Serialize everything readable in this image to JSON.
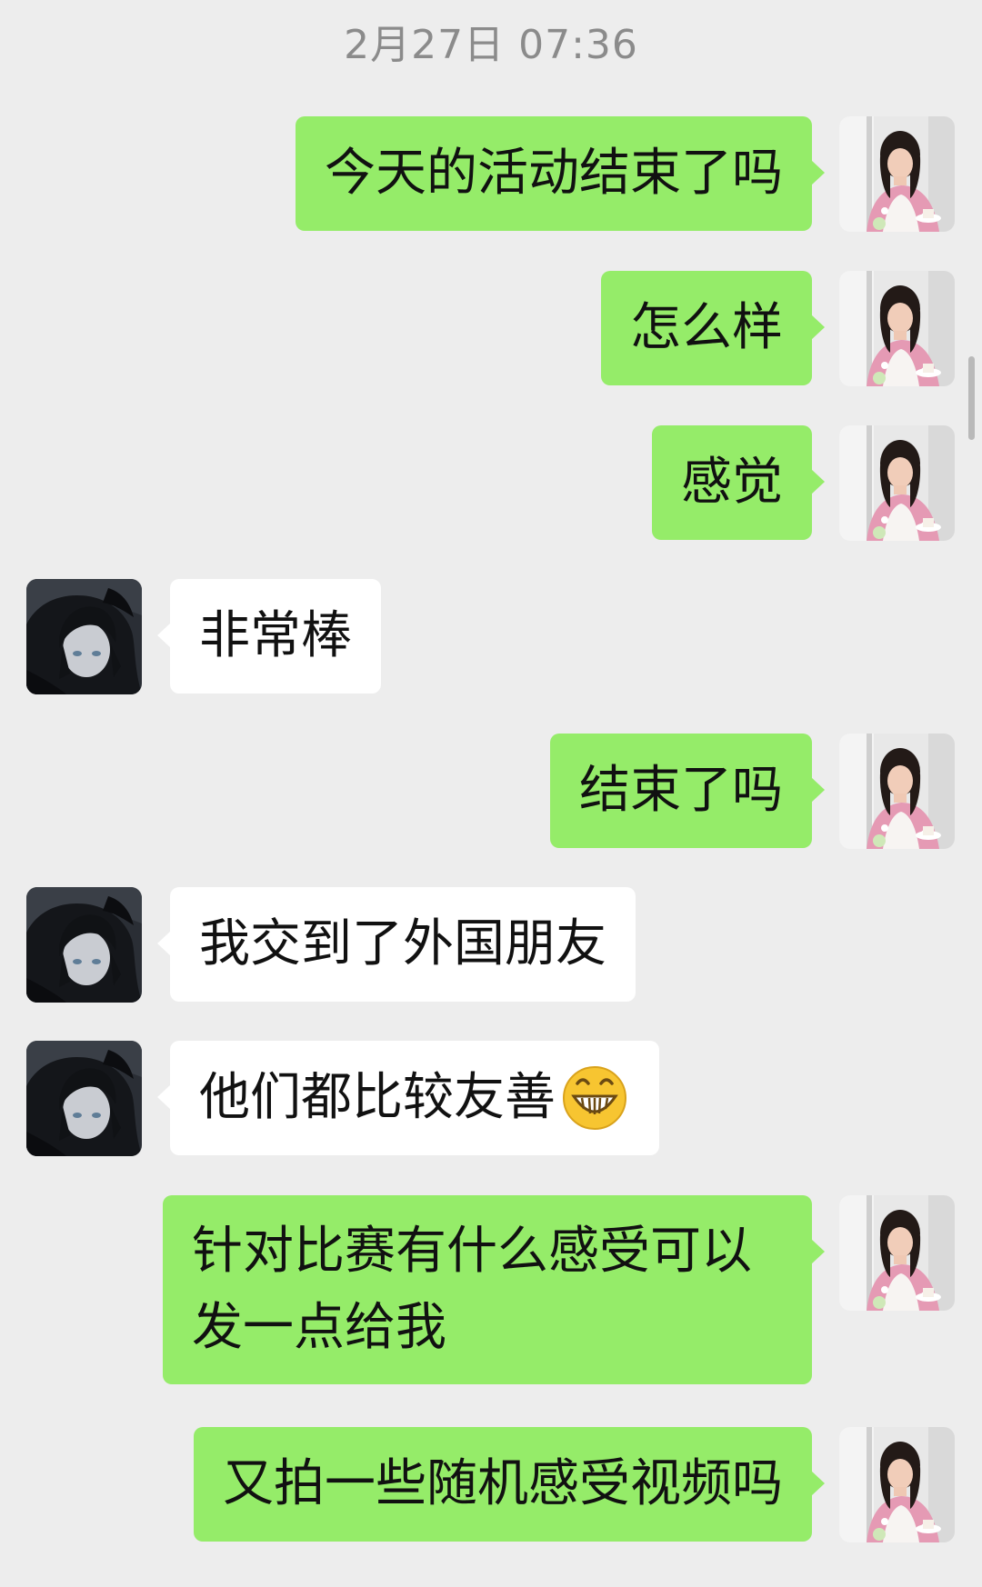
{
  "chat": {
    "timestamp": "2月27日 07:36",
    "messages": [
      {
        "side": "out",
        "text": "今天的活动结束了吗"
      },
      {
        "side": "out",
        "text": "怎么样"
      },
      {
        "side": "out",
        "text": "感觉"
      },
      {
        "side": "in",
        "text": "非常棒"
      },
      {
        "side": "out",
        "text": "结束了吗"
      },
      {
        "side": "in",
        "text": "我交到了外国朋友"
      },
      {
        "side": "in",
        "text": "他们都比较友善",
        "emoji": "grinning-face-emoji"
      },
      {
        "side": "out",
        "text": "针对比赛有什么感受可以发一点给我"
      },
      {
        "side": "out",
        "text": "又拍一些随机感受视频吗"
      }
    ]
  },
  "colors": {
    "background": "#ededed",
    "outgoing_bubble": "#95ec69",
    "incoming_bubble": "#ffffff",
    "timestamp_text": "#8b8b8b"
  },
  "icons": {
    "self_avatar": "photo-avatar",
    "contact_avatar": "anime-avatar"
  }
}
